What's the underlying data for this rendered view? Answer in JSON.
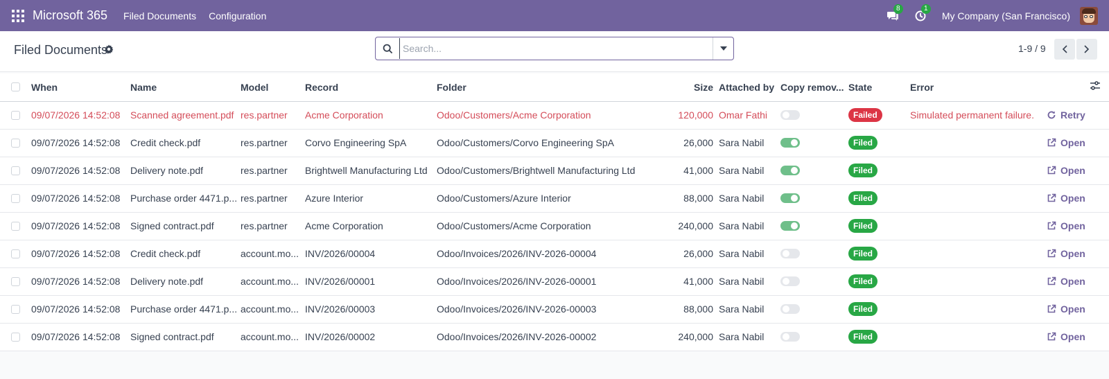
{
  "navbar": {
    "brand": "Microsoft 365",
    "menu": [
      "Filed Documents",
      "Configuration"
    ],
    "messages_count": "8",
    "activities_count": "1",
    "company": "My Company (San Francisco)"
  },
  "control_panel": {
    "title": "Filed Documents",
    "search_placeholder": "Search...",
    "pager": "1-9 / 9"
  },
  "table": {
    "columns": [
      "When",
      "Name",
      "Model",
      "Record",
      "Folder",
      "Size",
      "Attached by",
      "Copy remov...",
      "State",
      "Error"
    ],
    "rows": [
      {
        "when": "09/07/2026 14:52:08",
        "name": "Scanned agreement.pdf",
        "model": "res.partner",
        "record": "Acme Corporation",
        "folder": "Odoo/Customers/Acme Corporation",
        "size": "120,000",
        "attached_by": "Omar Fathi",
        "copy_removed": false,
        "state": "Failed",
        "error": "Simulated permanent failure.",
        "action": "Retry"
      },
      {
        "when": "09/07/2026 14:52:08",
        "name": "Credit check.pdf",
        "model": "res.partner",
        "record": "Corvo Engineering SpA",
        "folder": "Odoo/Customers/Corvo Engineering SpA",
        "size": "26,000",
        "attached_by": "Sara Nabil",
        "copy_removed": true,
        "state": "Filed",
        "error": "",
        "action": "Open"
      },
      {
        "when": "09/07/2026 14:52:08",
        "name": "Delivery note.pdf",
        "model": "res.partner",
        "record": "Brightwell Manufacturing Ltd",
        "folder": "Odoo/Customers/Brightwell Manufacturing Ltd",
        "size": "41,000",
        "attached_by": "Sara Nabil",
        "copy_removed": true,
        "state": "Filed",
        "error": "",
        "action": "Open"
      },
      {
        "when": "09/07/2026 14:52:08",
        "name": "Purchase order 4471.p...",
        "model": "res.partner",
        "record": "Azure Interior",
        "folder": "Odoo/Customers/Azure Interior",
        "size": "88,000",
        "attached_by": "Sara Nabil",
        "copy_removed": true,
        "state": "Filed",
        "error": "",
        "action": "Open"
      },
      {
        "when": "09/07/2026 14:52:08",
        "name": "Signed contract.pdf",
        "model": "res.partner",
        "record": "Acme Corporation",
        "folder": "Odoo/Customers/Acme Corporation",
        "size": "240,000",
        "attached_by": "Sara Nabil",
        "copy_removed": true,
        "state": "Filed",
        "error": "",
        "action": "Open"
      },
      {
        "when": "09/07/2026 14:52:08",
        "name": "Credit check.pdf",
        "model": "account.mo...",
        "record": "INV/2026/00004",
        "folder": "Odoo/Invoices/2026/INV-2026-00004",
        "size": "26,000",
        "attached_by": "Sara Nabil",
        "copy_removed": false,
        "state": "Filed",
        "error": "",
        "action": "Open"
      },
      {
        "when": "09/07/2026 14:52:08",
        "name": "Delivery note.pdf",
        "model": "account.mo...",
        "record": "INV/2026/00001",
        "folder": "Odoo/Invoices/2026/INV-2026-00001",
        "size": "41,000",
        "attached_by": "Sara Nabil",
        "copy_removed": false,
        "state": "Filed",
        "error": "",
        "action": "Open"
      },
      {
        "when": "09/07/2026 14:52:08",
        "name": "Purchase order 4471.p...",
        "model": "account.mo...",
        "record": "INV/2026/00003",
        "folder": "Odoo/Invoices/2026/INV-2026-00003",
        "size": "88,000",
        "attached_by": "Sara Nabil",
        "copy_removed": false,
        "state": "Filed",
        "error": "",
        "action": "Open"
      },
      {
        "when": "09/07/2026 14:52:08",
        "name": "Signed contract.pdf",
        "model": "account.mo...",
        "record": "INV/2026/00002",
        "folder": "Odoo/Invoices/2026/INV-2026-00002",
        "size": "240,000",
        "attached_by": "Sara Nabil",
        "copy_removed": false,
        "state": "Filed",
        "error": "",
        "action": "Open"
      }
    ]
  },
  "colors": {
    "navbar": "#71639e",
    "filed": "#28a745",
    "failed": "#dc3545",
    "error_text": "#d44c59",
    "toggle_on": "#6fbf8a"
  }
}
